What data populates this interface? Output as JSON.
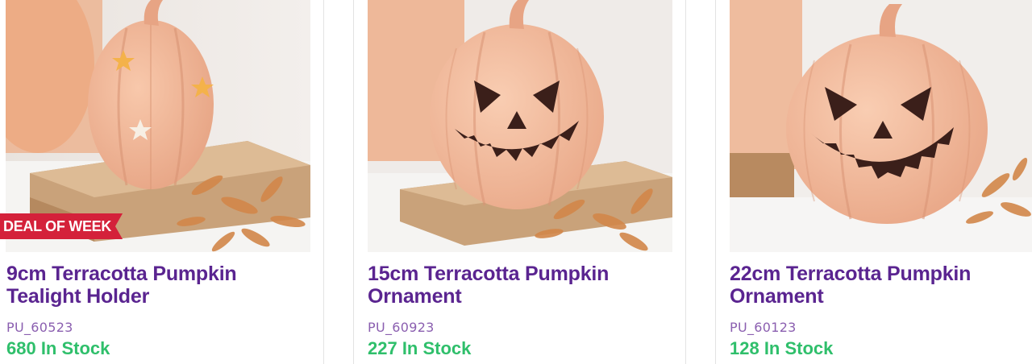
{
  "products": [
    {
      "title_line1": "9cm Terracotta Pumpkin",
      "title_line2": "Tealight Holder",
      "sku": "PU_60523",
      "stock": "680 In Stock",
      "badge": "DEAL OF WEEK",
      "image_alt": "Terracotta pumpkin tealight holder with star cutouts on wooden board"
    },
    {
      "title_line1": "15cm Terracotta Pumpkin",
      "title_line2": "Ornament",
      "sku": "PU_60923",
      "stock": "227 In Stock",
      "image_alt": "Terracotta jack-o-lantern pumpkin ornament on wooden board"
    },
    {
      "title_line1": "22cm Terracotta Pumpkin",
      "title_line2": "Ornament",
      "sku": "PU_60123",
      "stock": "128 In Stock",
      "image_alt": "Large terracotta jack-o-lantern pumpkin ornament"
    }
  ],
  "colors": {
    "title": "#5a2490",
    "sku": "#8b5fb0",
    "stock": "#2fbf6b",
    "badge_bg": "#d4213a",
    "pumpkin": "#f1b99a"
  }
}
